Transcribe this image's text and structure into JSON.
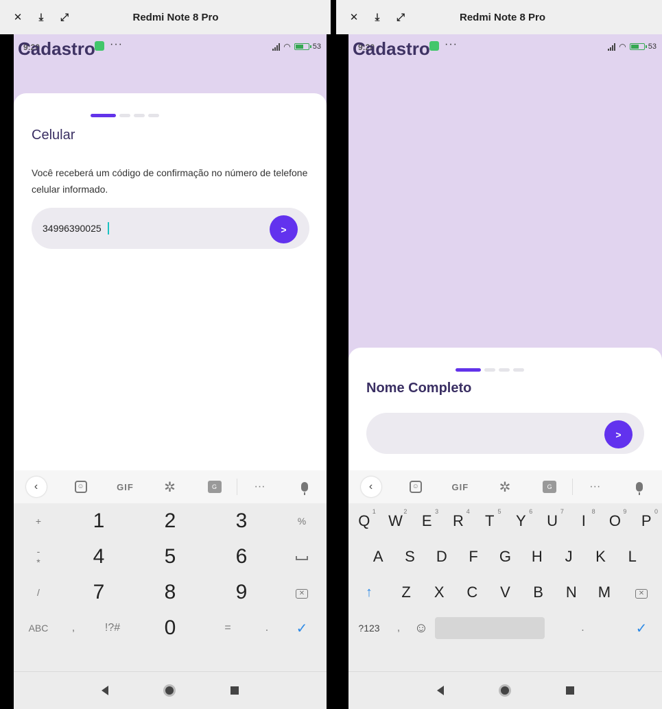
{
  "windows": [
    {
      "title": "Redmi Note 8 Pro",
      "app_title": "Cadastro",
      "status": {
        "clock": "9:20",
        "battery": "53"
      },
      "sheet": {
        "title": "Celular",
        "description": "Você receberá um código de confirmação no número de telefone celular informado.",
        "input_value": "34996390025",
        "submit_label": ">"
      },
      "keyboard": {
        "toolbar": {
          "gif": "GIF",
          "more": "···"
        },
        "rows": [
          {
            "side_left": "+",
            "keys": [
              "1",
              "2",
              "3"
            ],
            "side_right": "%"
          },
          {
            "side_left": "-",
            "keys": [
              "4",
              "5",
              "6"
            ],
            "side_right": "space"
          },
          {
            "side_left": "/",
            "keys": [
              "7",
              "8",
              "9"
            ],
            "side_right": "backspace"
          }
        ],
        "bottom": {
          "abc": "ABC",
          "comma": ",",
          "symbols": "!?#",
          "zero": "0",
          "equals": "=",
          "period": ".",
          "confirm": "✓"
        },
        "star": "*"
      }
    },
    {
      "title": "Redmi Note 8 Pro",
      "app_title": "Cadastro",
      "status": {
        "clock": "9:20",
        "battery": "53"
      },
      "sheet": {
        "title": "Nome Completo",
        "input_value": "",
        "submit_label": ">"
      },
      "keyboard": {
        "toolbar": {
          "gif": "GIF",
          "more": "···"
        },
        "row1": [
          {
            "k": "Q",
            "n": "1"
          },
          {
            "k": "W",
            "n": "2"
          },
          {
            "k": "E",
            "n": "3"
          },
          {
            "k": "R",
            "n": "4"
          },
          {
            "k": "T",
            "n": "5"
          },
          {
            "k": "Y",
            "n": "6"
          },
          {
            "k": "U",
            "n": "7"
          },
          {
            "k": "I",
            "n": "8"
          },
          {
            "k": "O",
            "n": "9"
          },
          {
            "k": "P",
            "n": "0"
          }
        ],
        "row2": [
          "A",
          "S",
          "D",
          "F",
          "G",
          "H",
          "J",
          "K",
          "L"
        ],
        "row3": [
          "Z",
          "X",
          "C",
          "V",
          "B",
          "N",
          "M"
        ],
        "bottom": {
          "num": "?123",
          "comma": ",",
          "period": ".",
          "confirm": "✓"
        }
      }
    }
  ],
  "colors": {
    "accent": "#6233ea",
    "header_bg": "#e1d4ef",
    "title": "#3f3364"
  }
}
